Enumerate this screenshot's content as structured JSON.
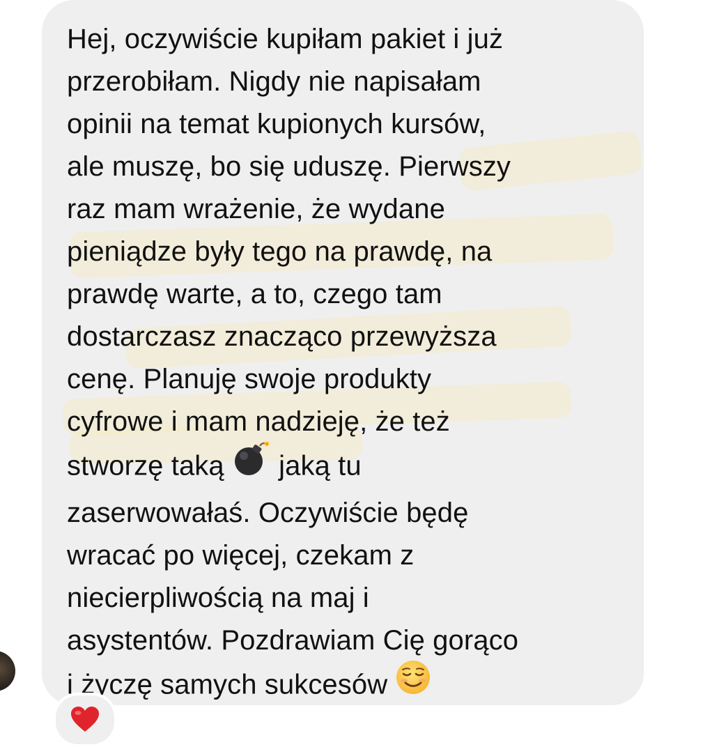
{
  "message": {
    "lines": [
      "Hej, oczywiście kupiłam pakiet i już",
      "przerobiłam. Nigdy nie napisałam",
      "opinii na temat kupionych kursów,",
      "ale muszę, bo się uduszę. Pierwszy",
      "raz mam wrażenie, że wydane",
      "pieniądze były tego na prawdę, na",
      "prawdę warte, a to, czego tam",
      "dostarczasz znacząco przewyższa",
      "cenę. Planuję swoje produkty",
      "cyfrowe i mam nadzieję, że też",
      "stworzę taką",
      "jaką tu",
      "zaserwowałaś. Oczywiście będę",
      "wracać po więcej, czekam z",
      "niecierpliwością na maj i",
      "asystentów. Pozdrawiam Cię gorąco",
      "i życzę samych sukcesów"
    ],
    "bubble_color": "#efeff0",
    "text_color": "#111111"
  },
  "icons": {
    "bomb": "bomb-icon",
    "smile": "smiling-face-icon",
    "heart": "heart-reaction-icon",
    "avatar": "avatar"
  },
  "reaction": {
    "heart_color": "#e0242b"
  }
}
